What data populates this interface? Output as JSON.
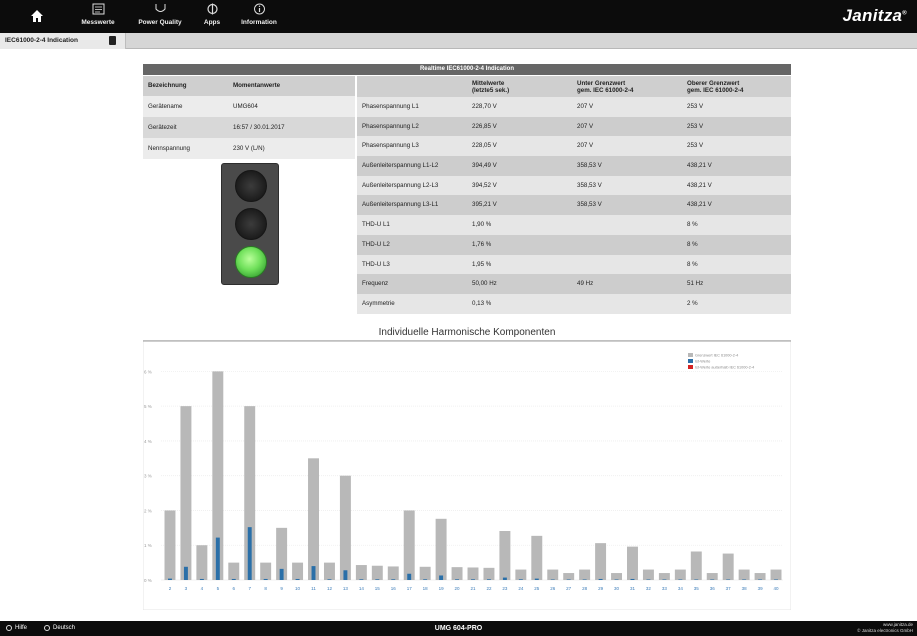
{
  "nav": {
    "items": [
      {
        "label": "Messwerte",
        "icon": "meter-icon"
      },
      {
        "label": "Power Quality",
        "icon": "power-quality-icon"
      },
      {
        "label": "Apps",
        "icon": "apps-icon"
      },
      {
        "label": "Information",
        "icon": "info-icon"
      }
    ],
    "brand": "Janitza",
    "brand_mark": "®",
    "home_icon": "home-icon"
  },
  "subbar": {
    "tab_label": "IEC61000-2-4 Indication"
  },
  "panel": {
    "title": "Realtime IEC61000-2-4 Indication",
    "left_headers": [
      "Bezeichnung",
      "Momentanwerte"
    ],
    "left_rows": [
      [
        "Gerätename",
        "UMG604"
      ],
      [
        "Gerätezeit",
        "16:57 / 30.01.2017"
      ],
      [
        "Nennspannung",
        "230 V (L/N)"
      ]
    ],
    "right_headers": [
      {
        "line1": "",
        "line2": ""
      },
      {
        "line1": "Mittelwerte",
        "line2": "(letzte5 sek.)"
      },
      {
        "line1": "Unter Grenzwert",
        "line2": "gem. IEC 61000-2-4"
      },
      {
        "line1": "Oberer Grenzwert",
        "line2": "gem. IEC 61000-2-4"
      }
    ],
    "right_rows": [
      [
        "Phasenspannung L1",
        "228,70 V",
        "207 V",
        "253 V"
      ],
      [
        "Phasenspannung L2",
        "226,85 V",
        "207 V",
        "253 V"
      ],
      [
        "Phasenspannung L3",
        "228,05 V",
        "207 V",
        "253 V"
      ],
      [
        "Außenleiterspannung L1-L2",
        "394,49 V",
        "358,53 V",
        "438,21 V"
      ],
      [
        "Außenleiterspannung L2-L3",
        "394,52 V",
        "358,53 V",
        "438,21 V"
      ],
      [
        "Außenleiterspannung L3-L1",
        "395,21 V",
        "358,53 V",
        "438,21 V"
      ],
      [
        "THD-U L1",
        "1,90 %",
        "",
        "8 %"
      ],
      [
        "THD-U L2",
        "1,76 %",
        "",
        "8 %"
      ],
      [
        "THD-U L3",
        "1,95 %",
        "",
        "8 %"
      ],
      [
        "Frequenz",
        "50,00 Hz",
        "49 Hz",
        "51 Hz"
      ],
      [
        "Asymmetrie",
        "0,13 %",
        "",
        "2 %"
      ]
    ],
    "traffic_light": {
      "active": "green"
    }
  },
  "chart_data": {
    "type": "bar",
    "title": "Individuelle Harmonische Komponenten",
    "categories": [
      "2",
      "3",
      "4",
      "5",
      "6",
      "7",
      "8",
      "9",
      "10",
      "11",
      "12",
      "13",
      "14",
      "15",
      "16",
      "17",
      "18",
      "19",
      "20",
      "21",
      "22",
      "23",
      "24",
      "25",
      "26",
      "27",
      "28",
      "29",
      "30",
      "31",
      "32",
      "33",
      "34",
      "35",
      "36",
      "37",
      "38",
      "39",
      "40"
    ],
    "yticks": [
      "0 %",
      "1 %",
      "2 %",
      "3 %",
      "4 %",
      "5 %",
      "6 %"
    ],
    "ylim": [
      0,
      6.5
    ],
    "grid": true,
    "legend_position": "top-right",
    "series": [
      {
        "name": "Grenzwert IEC 61000-2-4",
        "color": "#b8b8b8",
        "values": [
          2,
          5,
          1,
          6,
          0.5,
          5,
          0.5,
          1.5,
          0.5,
          3.5,
          0.5,
          3,
          0.43,
          0.41,
          0.39,
          2,
          0.38,
          1.76,
          0.37,
          0.36,
          0.35,
          1.41,
          0.3,
          1.27,
          0.3,
          0.2,
          0.3,
          1.06,
          0.2,
          0.96,
          0.3,
          0.2,
          0.3,
          0.82,
          0.2,
          0.76,
          0.3,
          0.2,
          0.3
        ]
      },
      {
        "name": "Ist-Werte",
        "color": "#2a6fa8",
        "values": [
          0.04,
          0.38,
          0.03,
          1.22,
          0.03,
          1.52,
          0.03,
          0.32,
          0.03,
          0.4,
          0.02,
          0.28,
          0.02,
          0.02,
          0.02,
          0.18,
          0.02,
          0.13,
          0.02,
          0.02,
          0.02,
          0.07,
          0.02,
          0.04,
          0.01,
          0.01,
          0.01,
          0.03,
          0.01,
          0.03,
          0.01,
          0.01,
          0.01,
          0.01,
          0.01,
          0.01,
          0.01,
          0.01,
          0.01
        ]
      },
      {
        "name": "Ist-Werte außerhalb IEC 61000-2-4",
        "color": "#d42222",
        "values": []
      }
    ]
  },
  "bottom": {
    "help_label": "Hilfe",
    "lang_label": "Deutsch",
    "device": "UMG 604-PRO",
    "site": "www.janitza.de",
    "copyright": "© Janitza electronics GmbH"
  }
}
